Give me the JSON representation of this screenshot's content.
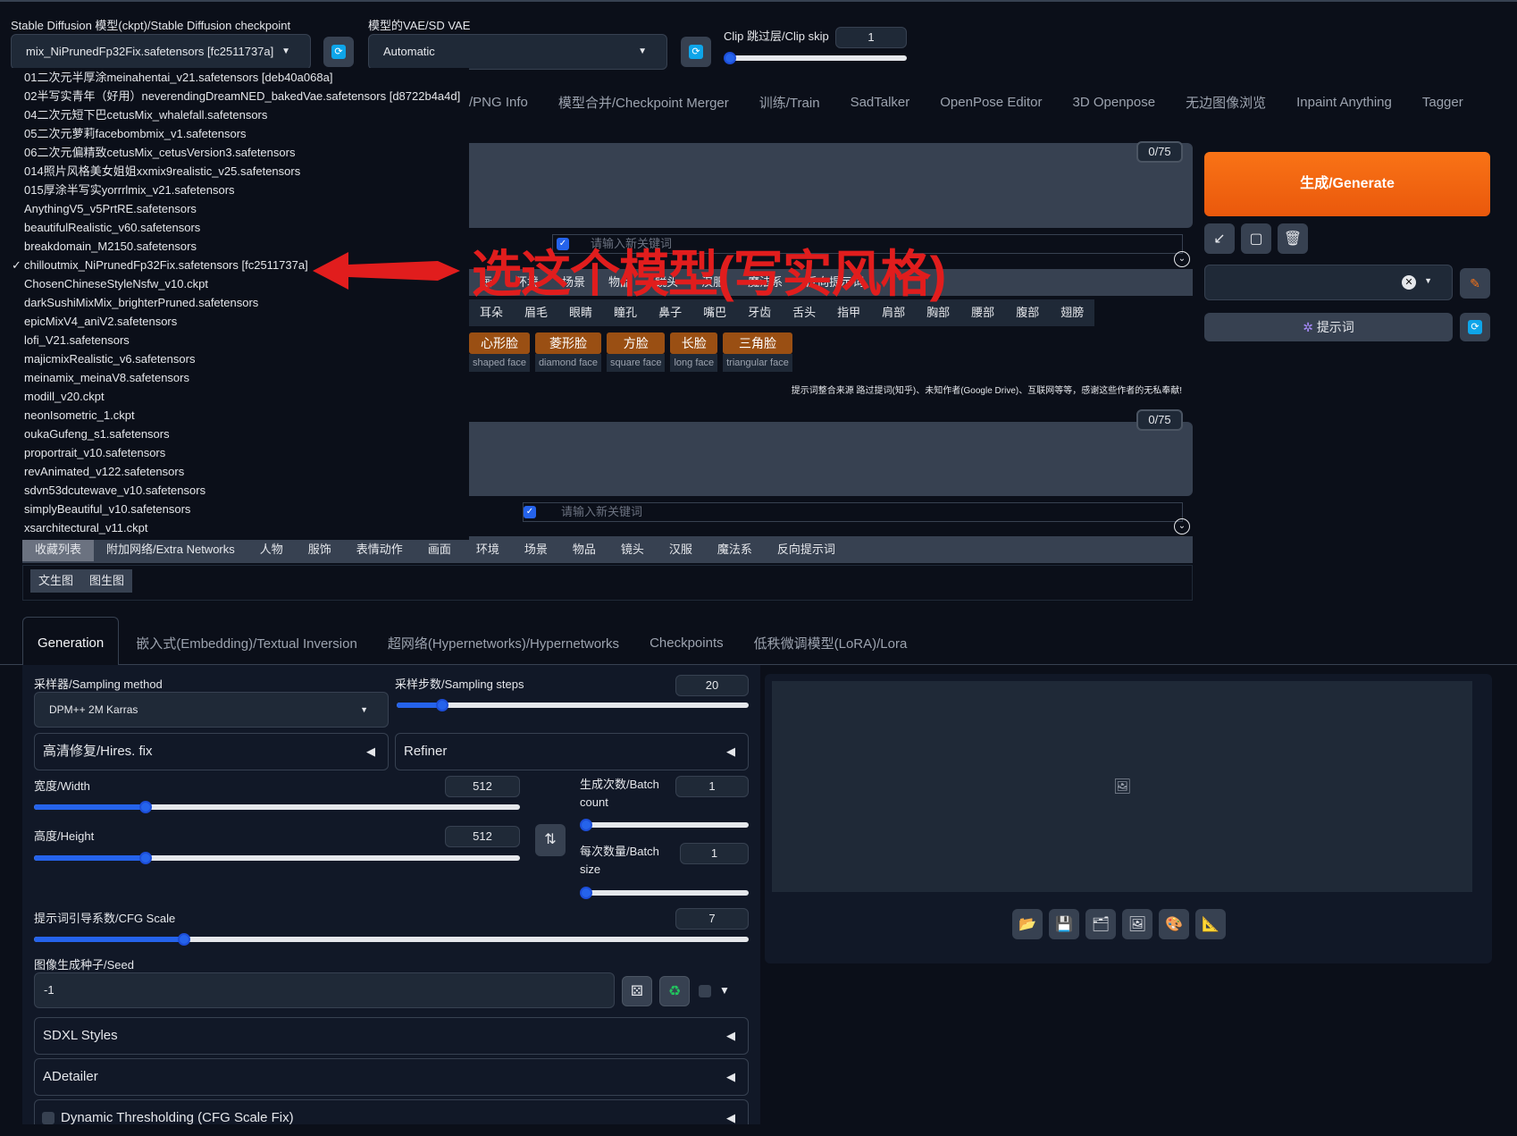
{
  "top": {
    "checkpoint_label": "Stable Diffusion 模型(ckpt)/Stable Diffusion checkpoint",
    "checkpoint_value": "mix_NiPrunedFp32Fix.safetensors [fc2511737a]",
    "vae_label": "模型的VAE/SD VAE",
    "vae_value": "Automatic",
    "clip_label": "Clip 跳过层/Clip skip",
    "clip_value": "1"
  },
  "checkpoint_list": [
    "01二次元半厚涂meinahentai_v21.safetensors [deb40a068a]",
    "02半写实青年（好用）neverendingDreamNED_bakedVae.safetensors [d8722b4a4d]",
    "04二次元短下巴cetusMix_whalefall.safetensors",
    "05二次元萝莉facebombmix_v1.safetensors",
    "06二次元偏精致cetusMix_cetusVersion3.safetensors",
    "014照片风格美女姐姐xxmix9realistic_v25.safetensors",
    "015厚涂半写实yorrrlmix_v21.safetensors",
    "AnythingV5_v5PrtRE.safetensors",
    "beautifulRealistic_v60.safetensors",
    "breakdomain_M2150.safetensors",
    "chilloutmix_NiPrunedFp32Fix.safetensors [fc2511737a]",
    "ChosenChineseStyleNsfw_v10.ckpt",
    "darkSushiMixMix_brighterPruned.safetensors",
    "epicMixV4_aniV2.safetensors",
    "lofi_V21.safetensors",
    "majicmixRealistic_v6.safetensors",
    "meinamix_meinaV8.safetensors",
    "modill_v20.ckpt",
    "neonIsometric_1.ckpt",
    "oukaGufeng_s1.safetensors",
    "proportrait_v10.safetensors",
    "revAnimated_v122.safetensors",
    "sdvn53dcutewave_v10.safetensors",
    "simplyBeautiful_v10.safetensors",
    "xsarchitectural_v11.ckpt"
  ],
  "selected_checkmark": "✓",
  "annotation": "选这个模型(写实风格)",
  "main_tabs": [
    "/PNG Info",
    "模型合并/Checkpoint Merger",
    "训练/Train",
    "SadTalker",
    "OpenPose Editor",
    "3D Openpose",
    "无边图像浏览",
    "Inpaint Anything",
    "Tagger"
  ],
  "prompt": {
    "counter": "0/75",
    "keyword_placeholder": "请输入新关键词",
    "category_tabs": [
      "画",
      "环境",
      "场景",
      "物品",
      "镜头",
      "汉服",
      "魔法系",
      "反向提示词"
    ],
    "body_parts": [
      "耳朵",
      "眉毛",
      "眼睛",
      "瞳孔",
      "鼻子",
      "嘴巴",
      "牙齿",
      "舌头",
      "指甲",
      "肩部",
      "胸部",
      "腰部",
      "腹部",
      "翅膀"
    ],
    "faces": [
      {
        "cn": "心形脸",
        "en": "shaped face"
      },
      {
        "cn": "菱形脸",
        "en": "diamond face"
      },
      {
        "cn": "方脸",
        "en": "square face"
      },
      {
        "cn": "长脸",
        "en": "long face"
      },
      {
        "cn": "三角脸",
        "en": "triangular face"
      }
    ],
    "credit": "提示词整合来源 路过提词(知乎)、未知作者(Google Drive)、互联网等等，感谢这些作者的无私奉献!"
  },
  "negative": {
    "counter": "0/75",
    "keyword_placeholder": "请输入新关键词",
    "tabs": [
      "收藏列表",
      "附加网络/Extra Networks",
      "人物",
      "服饰",
      "表情动作",
      "画面",
      "环境",
      "场景",
      "物品",
      "镜头",
      "汉服",
      "魔法系",
      "反向提示词"
    ],
    "sub_tabs": [
      "文生图",
      "图生图"
    ]
  },
  "right": {
    "generate": "生成/Generate",
    "prompt_btn": "提示词"
  },
  "gen_tabs": [
    "Generation",
    "嵌入式(Embedding)/Textual Inversion",
    "超网络(Hypernetworks)/Hypernetworks",
    "Checkpoints",
    "低秩微调模型(LoRA)/Lora"
  ],
  "gen": {
    "sampler_label": "采样器/Sampling method",
    "sampler_value": "DPM++ 2M Karras",
    "steps_label": "采样步数/Sampling steps",
    "steps_value": "20",
    "steps_fraction": 0.13,
    "hires": "高清修复/Hires. fix",
    "refiner": "Refiner",
    "width_label": "宽度/Width",
    "width_value": "512",
    "width_fraction": 0.23,
    "height_label": "高度/Height",
    "height_value": "512",
    "height_fraction": 0.23,
    "batch_count_label": "生成次数/Batch count",
    "batch_count_value": "1",
    "batch_size_label": "每次数量/Batch size",
    "batch_size_value": "1",
    "cfg_label": "提示词引导系数/CFG Scale",
    "cfg_value": "7",
    "cfg_fraction": 0.21,
    "seed_label": "图像生成种子/Seed",
    "seed_value": "-1",
    "accordions": [
      "SDXL Styles",
      "ADetailer",
      "Dynamic Thresholding (CFG Scale Fix)"
    ]
  }
}
